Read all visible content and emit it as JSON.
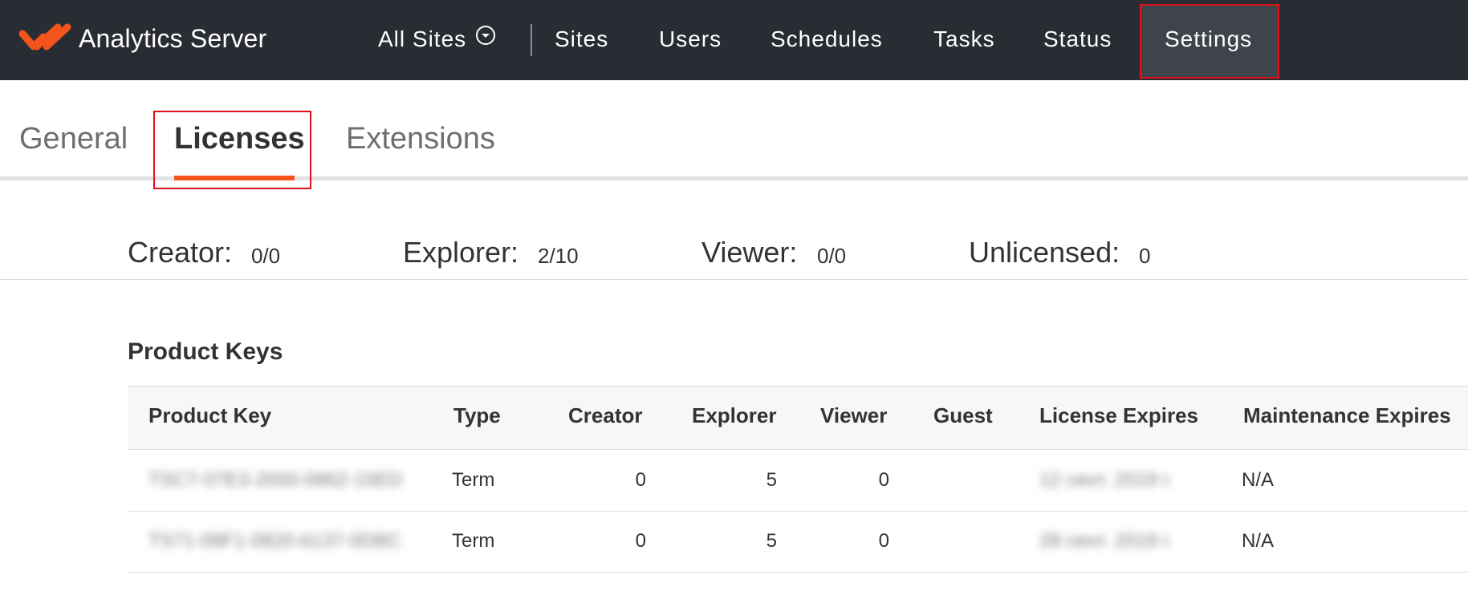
{
  "header": {
    "app_name": "Analytics Server",
    "site_selector": "All Sites",
    "nav": [
      "Sites",
      "Users",
      "Schedules",
      "Tasks",
      "Status",
      "Settings"
    ],
    "active_nav": "Settings",
    "logo_color": "#f2541b"
  },
  "tabs": {
    "items": [
      "General",
      "Licenses",
      "Extensions"
    ],
    "active": "Licenses",
    "accent": "#f2541b"
  },
  "license_counts": [
    {
      "label": "Creator:",
      "value": "0/0"
    },
    {
      "label": "Explorer:",
      "value": "2/10"
    },
    {
      "label": "Viewer:",
      "value": "0/0"
    },
    {
      "label": "Unlicensed:",
      "value": "0"
    }
  ],
  "product_keys": {
    "title": "Product Keys",
    "columns": [
      "Product Key",
      "Type",
      "Creator",
      "Explorer",
      "Viewer",
      "Guest",
      "License Expires",
      "Maintenance Expires"
    ],
    "rows": [
      {
        "key": "TSC7-07E3-2000-0862-15ED",
        "type": "Term",
        "creator": "0",
        "explorer": "5",
        "viewer": "0",
        "guest": "",
        "license_expires": "12 сент. 2019 г.",
        "maintenance_expires": "N/A"
      },
      {
        "key": "TS71-08F1-0820-6137-0DBC",
        "type": "Term",
        "creator": "0",
        "explorer": "5",
        "viewer": "0",
        "guest": "",
        "license_expires": "28 сент. 2019 г.",
        "maintenance_expires": "N/A"
      }
    ]
  },
  "highlight_color": "#e3101b"
}
